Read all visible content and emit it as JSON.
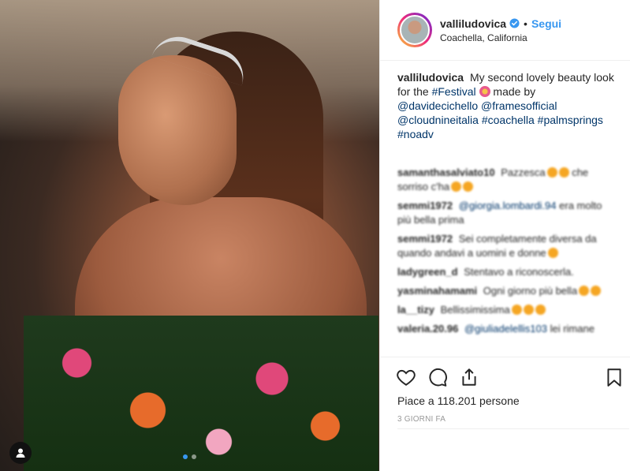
{
  "post": {
    "image_alt": "Photo of a smiling woman with a jeweled headpiece at a festival",
    "carousel": {
      "total": 2,
      "active": 0
    }
  },
  "header": {
    "username": "valliludovica",
    "separator": "•",
    "follow_label": "Segui",
    "location": "Coachella, California"
  },
  "caption": {
    "username": "valliludovica",
    "text_1": "My second lovely beauty look for the",
    "tag_festival": "#Festival",
    "text_2": "made by",
    "mentions": [
      "@davidecichello",
      "@framesofficial",
      "@cloudnineitalia"
    ],
    "tags": [
      "#coachella",
      "#palmsprings",
      "#noadv"
    ]
  },
  "comments": [
    {
      "user": "samanthasalviato10",
      "text": "Pazzesca",
      "emoji_after": true,
      "text2": "che sorriso c'ha"
    },
    {
      "user": "semmi1972",
      "mention": "@giorgia.lombardi.94",
      "text": "era molto più bella prima"
    },
    {
      "user": "semmi1972",
      "text": "Sei completamente diversa da quando andavi a uomini e donne"
    },
    {
      "user": "ladygreen_d",
      "text": "Stentavo a riconoscerla."
    },
    {
      "user": "yasminahamami",
      "text": "Ogni giorno più bella"
    },
    {
      "user": "la__tizy",
      "text": "Bellissimissima"
    },
    {
      "user": "valeria.20.96",
      "mention": "@giuliadelellis103",
      "text": "lei rimane"
    }
  ],
  "actions": {
    "like_icon": "heart-icon",
    "comment_icon": "comment-icon",
    "share_icon": "share-icon",
    "save_icon": "bookmark-icon"
  },
  "likes_text": "Piace a 118.201 persone",
  "time_text": "3 GIORNI FA",
  "colors": {
    "link": "#003569",
    "follow": "#3897f0",
    "muted": "#999999"
  }
}
